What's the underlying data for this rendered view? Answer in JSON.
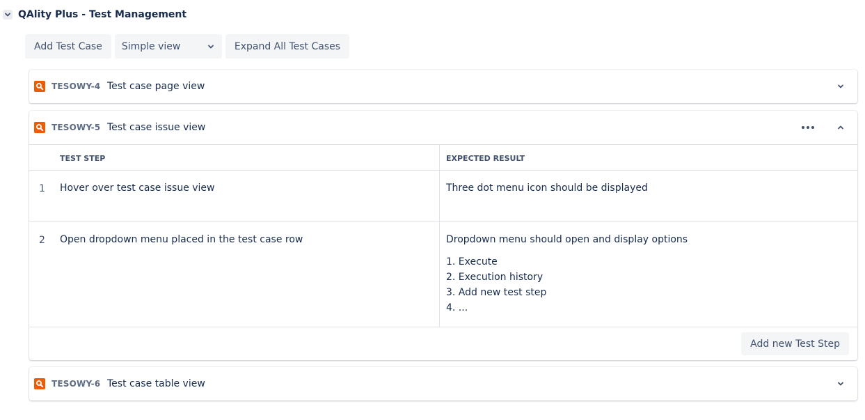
{
  "section": {
    "title": "QAlity Plus - Test Management"
  },
  "toolbar": {
    "add_test_case": "Add Test Case",
    "view_select": "Simple view",
    "expand_all": "Expand All Test Cases"
  },
  "test_cases": [
    {
      "key": "TESOWY-4",
      "summary": "Test case page view"
    },
    {
      "key": "TESOWY-5",
      "summary": "Test case issue view"
    },
    {
      "key": "TESOWY-6",
      "summary": "Test case table view"
    }
  ],
  "steps_table": {
    "header_step": "TEST STEP",
    "header_expected": "EXPECTED RESULT",
    "rows": [
      {
        "num": "1",
        "step": "Hover over test case issue view",
        "expected": "Three dot menu icon should be displayed"
      },
      {
        "num": "2",
        "step": "Open dropdown menu placed in the test case row",
        "expected": "Dropdown menu should open and display options",
        "expected_list": [
          "1. Execute",
          "2. Execution history",
          "3. Add new test step",
          "4. ..."
        ]
      }
    ],
    "add_step_label": "Add new Test Step"
  },
  "colors": {
    "issue_icon": "#e95d05",
    "text": "#172b4d",
    "muted": "#42526e",
    "button_bg": "#f4f5f7"
  },
  "icons": [
    "chevron-down-icon",
    "search-icon",
    "more-icon",
    "chevron-up-icon"
  ]
}
